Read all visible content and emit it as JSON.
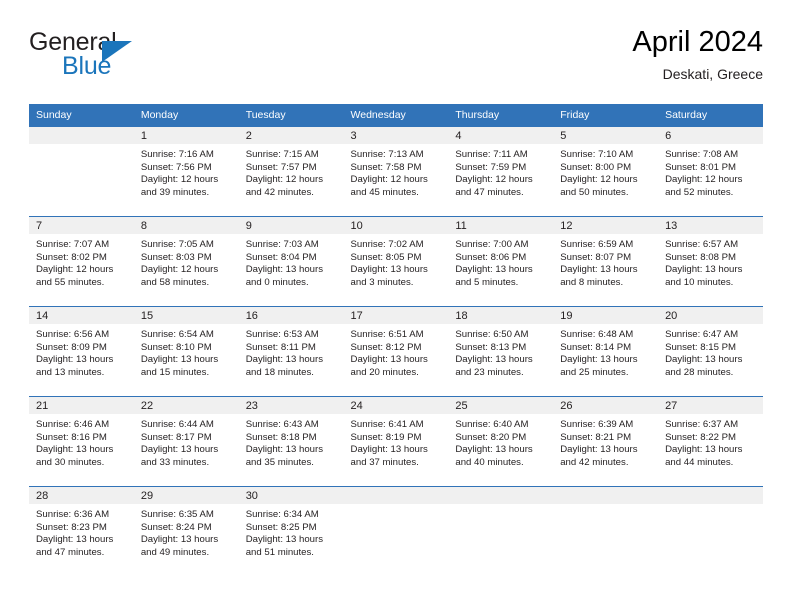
{
  "brand": {
    "name_top": "General",
    "name_bottom": "Blue",
    "accent_color": "#1b75bb"
  },
  "header": {
    "title": "April 2024",
    "subtitle": "Deskati, Greece"
  },
  "theme": {
    "header_blue": "#3173b8",
    "daynum_band": "#f0f0f0",
    "text": "#231f20"
  },
  "weekday_headers": [
    "Sunday",
    "Monday",
    "Tuesday",
    "Wednesday",
    "Thursday",
    "Friday",
    "Saturday"
  ],
  "weeks": [
    [
      {
        "day": "",
        "lines": []
      },
      {
        "day": "1",
        "lines": [
          "Sunrise: 7:16 AM",
          "Sunset: 7:56 PM",
          "Daylight: 12 hours",
          "and 39 minutes."
        ]
      },
      {
        "day": "2",
        "lines": [
          "Sunrise: 7:15 AM",
          "Sunset: 7:57 PM",
          "Daylight: 12 hours",
          "and 42 minutes."
        ]
      },
      {
        "day": "3",
        "lines": [
          "Sunrise: 7:13 AM",
          "Sunset: 7:58 PM",
          "Daylight: 12 hours",
          "and 45 minutes."
        ]
      },
      {
        "day": "4",
        "lines": [
          "Sunrise: 7:11 AM",
          "Sunset: 7:59 PM",
          "Daylight: 12 hours",
          "and 47 minutes."
        ]
      },
      {
        "day": "5",
        "lines": [
          "Sunrise: 7:10 AM",
          "Sunset: 8:00 PM",
          "Daylight: 12 hours",
          "and 50 minutes."
        ]
      },
      {
        "day": "6",
        "lines": [
          "Sunrise: 7:08 AM",
          "Sunset: 8:01 PM",
          "Daylight: 12 hours",
          "and 52 minutes."
        ]
      }
    ],
    [
      {
        "day": "7",
        "lines": [
          "Sunrise: 7:07 AM",
          "Sunset: 8:02 PM",
          "Daylight: 12 hours",
          "and 55 minutes."
        ]
      },
      {
        "day": "8",
        "lines": [
          "Sunrise: 7:05 AM",
          "Sunset: 8:03 PM",
          "Daylight: 12 hours",
          "and 58 minutes."
        ]
      },
      {
        "day": "9",
        "lines": [
          "Sunrise: 7:03 AM",
          "Sunset: 8:04 PM",
          "Daylight: 13 hours",
          "and 0 minutes."
        ]
      },
      {
        "day": "10",
        "lines": [
          "Sunrise: 7:02 AM",
          "Sunset: 8:05 PM",
          "Daylight: 13 hours",
          "and 3 minutes."
        ]
      },
      {
        "day": "11",
        "lines": [
          "Sunrise: 7:00 AM",
          "Sunset: 8:06 PM",
          "Daylight: 13 hours",
          "and 5 minutes."
        ]
      },
      {
        "day": "12",
        "lines": [
          "Sunrise: 6:59 AM",
          "Sunset: 8:07 PM",
          "Daylight: 13 hours",
          "and 8 minutes."
        ]
      },
      {
        "day": "13",
        "lines": [
          "Sunrise: 6:57 AM",
          "Sunset: 8:08 PM",
          "Daylight: 13 hours",
          "and 10 minutes."
        ]
      }
    ],
    [
      {
        "day": "14",
        "lines": [
          "Sunrise: 6:56 AM",
          "Sunset: 8:09 PM",
          "Daylight: 13 hours",
          "and 13 minutes."
        ]
      },
      {
        "day": "15",
        "lines": [
          "Sunrise: 6:54 AM",
          "Sunset: 8:10 PM",
          "Daylight: 13 hours",
          "and 15 minutes."
        ]
      },
      {
        "day": "16",
        "lines": [
          "Sunrise: 6:53 AM",
          "Sunset: 8:11 PM",
          "Daylight: 13 hours",
          "and 18 minutes."
        ]
      },
      {
        "day": "17",
        "lines": [
          "Sunrise: 6:51 AM",
          "Sunset: 8:12 PM",
          "Daylight: 13 hours",
          "and 20 minutes."
        ]
      },
      {
        "day": "18",
        "lines": [
          "Sunrise: 6:50 AM",
          "Sunset: 8:13 PM",
          "Daylight: 13 hours",
          "and 23 minutes."
        ]
      },
      {
        "day": "19",
        "lines": [
          "Sunrise: 6:48 AM",
          "Sunset: 8:14 PM",
          "Daylight: 13 hours",
          "and 25 minutes."
        ]
      },
      {
        "day": "20",
        "lines": [
          "Sunrise: 6:47 AM",
          "Sunset: 8:15 PM",
          "Daylight: 13 hours",
          "and 28 minutes."
        ]
      }
    ],
    [
      {
        "day": "21",
        "lines": [
          "Sunrise: 6:46 AM",
          "Sunset: 8:16 PM",
          "Daylight: 13 hours",
          "and 30 minutes."
        ]
      },
      {
        "day": "22",
        "lines": [
          "Sunrise: 6:44 AM",
          "Sunset: 8:17 PM",
          "Daylight: 13 hours",
          "and 33 minutes."
        ]
      },
      {
        "day": "23",
        "lines": [
          "Sunrise: 6:43 AM",
          "Sunset: 8:18 PM",
          "Daylight: 13 hours",
          "and 35 minutes."
        ]
      },
      {
        "day": "24",
        "lines": [
          "Sunrise: 6:41 AM",
          "Sunset: 8:19 PM",
          "Daylight: 13 hours",
          "and 37 minutes."
        ]
      },
      {
        "day": "25",
        "lines": [
          "Sunrise: 6:40 AM",
          "Sunset: 8:20 PM",
          "Daylight: 13 hours",
          "and 40 minutes."
        ]
      },
      {
        "day": "26",
        "lines": [
          "Sunrise: 6:39 AM",
          "Sunset: 8:21 PM",
          "Daylight: 13 hours",
          "and 42 minutes."
        ]
      },
      {
        "day": "27",
        "lines": [
          "Sunrise: 6:37 AM",
          "Sunset: 8:22 PM",
          "Daylight: 13 hours",
          "and 44 minutes."
        ]
      }
    ],
    [
      {
        "day": "28",
        "lines": [
          "Sunrise: 6:36 AM",
          "Sunset: 8:23 PM",
          "Daylight: 13 hours",
          "and 47 minutes."
        ]
      },
      {
        "day": "29",
        "lines": [
          "Sunrise: 6:35 AM",
          "Sunset: 8:24 PM",
          "Daylight: 13 hours",
          "and 49 minutes."
        ]
      },
      {
        "day": "30",
        "lines": [
          "Sunrise: 6:34 AM",
          "Sunset: 8:25 PM",
          "Daylight: 13 hours",
          "and 51 minutes."
        ]
      },
      {
        "day": "",
        "lines": []
      },
      {
        "day": "",
        "lines": []
      },
      {
        "day": "",
        "lines": []
      },
      {
        "day": "",
        "lines": []
      }
    ]
  ]
}
